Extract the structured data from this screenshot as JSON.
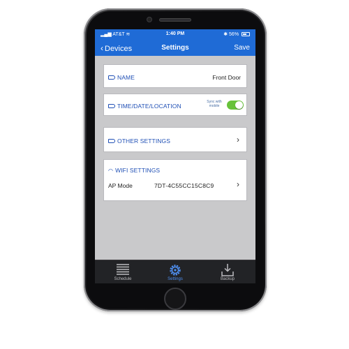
{
  "statusbar": {
    "carrier": "AT&T",
    "time": "1:40 PM",
    "battery": "56%"
  },
  "navbar": {
    "back_label": "Devices",
    "title": "Settings",
    "save_label": "Save"
  },
  "settings": {
    "name": {
      "label": "NAME",
      "value": "Front Door"
    },
    "time_date_location": {
      "label": "TIME/DATE/LOCATION",
      "sync_text": "Sync with mobile",
      "sync_enabled": true
    },
    "other_settings": {
      "label": "OTHER SETTINGS"
    },
    "wifi": {
      "label": "WIFI SETTINGS",
      "mode_label": "AP Mode",
      "mode_value": "7DT-4C55CC15C8C9"
    }
  },
  "tabs": [
    {
      "label": "Schedule",
      "icon": "schedule-list-icon",
      "active": false
    },
    {
      "label": "Settings",
      "icon": "gear-icon",
      "active": true
    },
    {
      "label": "Backup",
      "icon": "download-icon",
      "active": false
    }
  ],
  "colors": {
    "accent_blue": "#1f6bd6",
    "label_blue": "#1f4fb5",
    "toggle_green": "#67c23a",
    "tabbar_dark": "#222326",
    "screen_background": "#c9c9cb"
  }
}
